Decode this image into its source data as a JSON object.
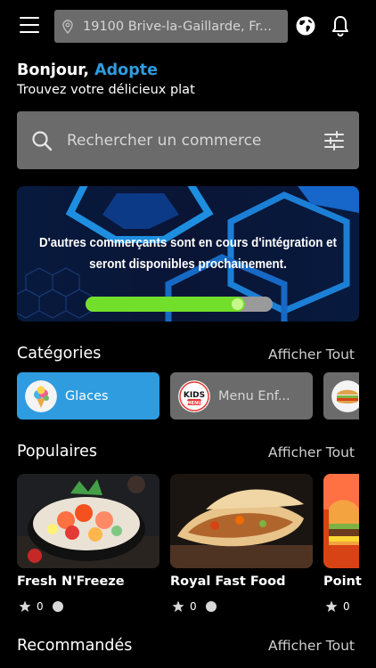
{
  "header": {
    "location": "19100 Brive-la-Gaillarde, Fr...",
    "icons": [
      "menu-icon",
      "map-pin-icon",
      "globe-icon",
      "bell-icon"
    ]
  },
  "greeting": {
    "hello": "Bonjour,",
    "name": "Adopte",
    "subtitle": "Trouvez votre délicieux plat"
  },
  "search": {
    "placeholder": "Rechercher un commerce"
  },
  "banner": {
    "line1": "D'autres commerçants sont en cours d'intégration et",
    "line2": "seront disponibles prochainement.",
    "progress": 0.85
  },
  "categories": {
    "title": "Catégories",
    "see_all": "Afficher Tout",
    "items": [
      {
        "label": "Glaces",
        "selected": true
      },
      {
        "label": "Menu Enf...",
        "logo_text": "KIDS",
        "logo_sub": "MENU",
        "selected": false
      },
      {
        "label": "",
        "selected": false
      }
    ]
  },
  "popular": {
    "title": "Populaires",
    "see_all": "Afficher Tout",
    "items": [
      {
        "name": "Fresh N'Freeze",
        "rating": "0"
      },
      {
        "name": "Royal Fast Food",
        "rating": "0"
      },
      {
        "name": "Point",
        "rating": "0"
      }
    ]
  },
  "recommended": {
    "title": "Recommandés",
    "see_all": "Afficher Tout"
  },
  "colors": {
    "accent": "#2f9cdf",
    "surface": "#6b6b6b",
    "progress": "#72e02a",
    "background": "#000000"
  }
}
